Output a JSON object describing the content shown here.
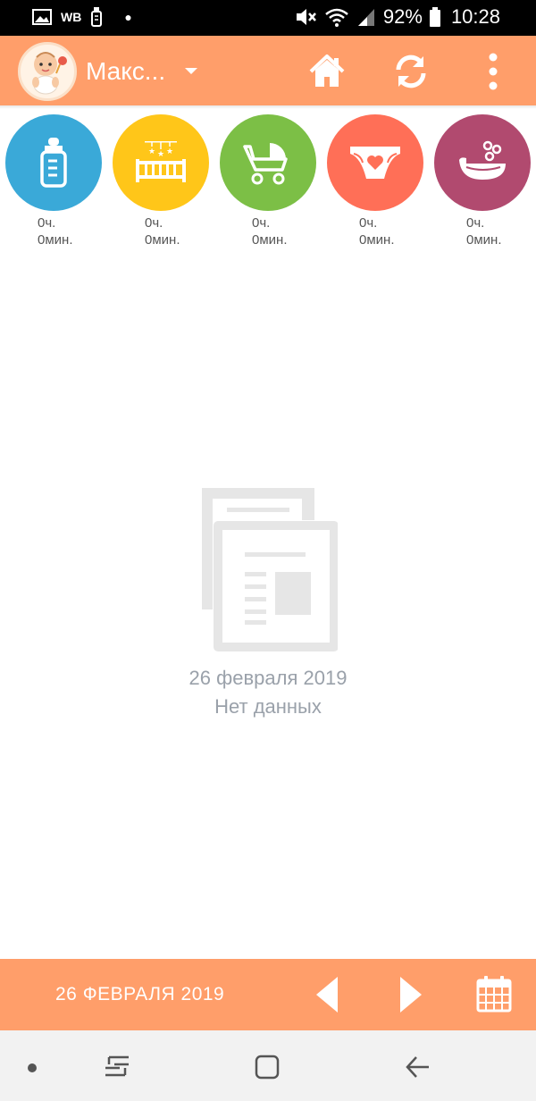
{
  "status_bar": {
    "carrier_badge": "WB",
    "battery": "92%",
    "time": "10:28"
  },
  "header": {
    "child_name": "Макс...",
    "colors": {
      "accent": "#ff9e6a"
    }
  },
  "activities": [
    {
      "name": "feeding",
      "icon": "bottle-icon",
      "color": "#3aa9d8",
      "hours": "0ч.",
      "minutes": "0мин."
    },
    {
      "name": "sleep",
      "icon": "crib-icon",
      "color": "#ffc619",
      "hours": "0ч.",
      "minutes": "0мин."
    },
    {
      "name": "walk",
      "icon": "stroller-icon",
      "color": "#7cbf46",
      "hours": "0ч.",
      "minutes": "0мин."
    },
    {
      "name": "diaper",
      "icon": "diaper-icon",
      "color": "#ff6f57",
      "hours": "0ч.",
      "minutes": "0мин."
    },
    {
      "name": "bath",
      "icon": "bathtub-icon",
      "color": "#b14a6f",
      "hours": "0ч.",
      "minutes": "0мин."
    }
  ],
  "empty_state": {
    "date": "26 февраля 2019",
    "message": "Нет данных"
  },
  "date_bar": {
    "label": "26 ФЕВРАЛЯ 2019"
  }
}
